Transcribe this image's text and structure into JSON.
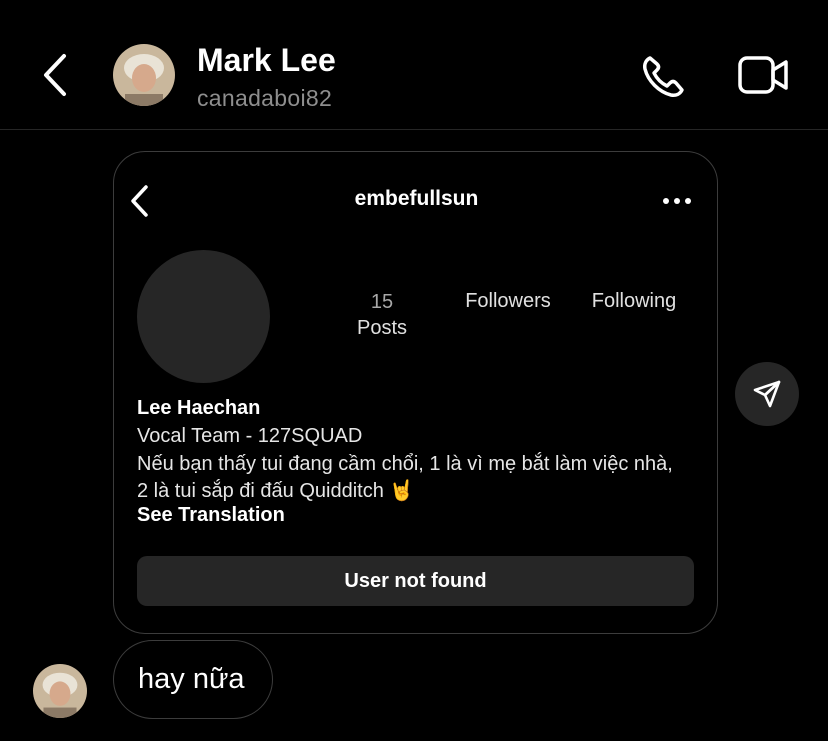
{
  "header": {
    "contact_name": "Mark Lee",
    "contact_handle": "canadaboi82",
    "icons": {
      "back": "chevron-left-icon",
      "call": "phone-icon",
      "video": "video-camera-icon"
    }
  },
  "shared_profile": {
    "username": "embefullsun",
    "stats": {
      "posts_count": "15",
      "posts_label": "Posts",
      "followers_label": "Followers",
      "following_label": "Following"
    },
    "bio": {
      "name": "Lee Haechan",
      "category": "Vocal Team - 127SQUAD",
      "text": "Nếu bạn thấy tui đang cầm chổi, 1 là vì mẹ bắt làm việc nhà, 2 là tui sắp đi đấu Quidditch 🤘",
      "see_translation": "See Translation"
    },
    "status_button": "User not found"
  },
  "message": {
    "text": "hay nữa"
  },
  "colors": {
    "background": "#000000",
    "secondary_text": "#8e8e8e",
    "button_bg": "#262626",
    "border": "#3c3c3c"
  }
}
